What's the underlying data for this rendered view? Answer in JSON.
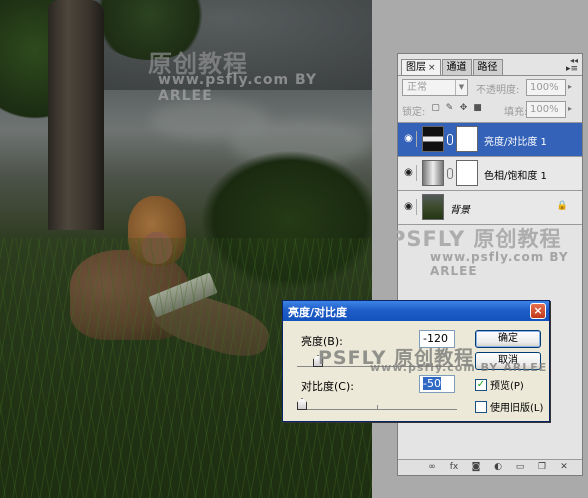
{
  "watermark": {
    "photo_big": "原创教程",
    "photo_small": "www.psfly.com  BY ARLEE",
    "panel_big": "PSFLY 原创教程",
    "panel_small": "www.psfly.com  BY ARLEE",
    "dialog_big": "PSFLY 原创教程",
    "dialog_small": "www.psfly.com  BY ARLEE"
  },
  "layers_panel": {
    "tabs": [
      {
        "label": "图层",
        "active": true
      },
      {
        "label": "通道",
        "active": false
      },
      {
        "label": "路径",
        "active": false
      }
    ],
    "tab_close": "×",
    "blend_mode": "正常",
    "opacity_label": "不透明度:",
    "opacity_value": "100%",
    "lock_label": "锁定:",
    "fill_label": "填充:",
    "fill_value": "100%",
    "layers": [
      {
        "name": "亮度/对比度 1",
        "selected": true,
        "has_mask": true
      },
      {
        "name": "色相/饱和度 1",
        "selected": false,
        "has_mask": true
      },
      {
        "name": "背景",
        "selected": false,
        "has_mask": false,
        "locked": true
      }
    ],
    "footer_icons": [
      "link-icon",
      "fx-icon",
      "mask-icon",
      "adjustment-icon",
      "folder-icon",
      "new-layer-icon",
      "trash-icon"
    ]
  },
  "dialog": {
    "title": "亮度/对比度",
    "close_glyph": "×",
    "brightness_label": "亮度(B):",
    "brightness_value": "-120",
    "brightness_fraction": 0.1,
    "contrast_label": "对比度(C):",
    "contrast_value": "-50",
    "contrast_fraction": 0.0,
    "ok_label": "确定",
    "cancel_label": "取消",
    "preview_label": "预览(P)",
    "preview_checked": true,
    "legacy_label": "使用旧版(L)",
    "legacy_checked": false
  },
  "colors": {
    "accent": "#3462b8",
    "titlebar": "#1f5ec8"
  }
}
